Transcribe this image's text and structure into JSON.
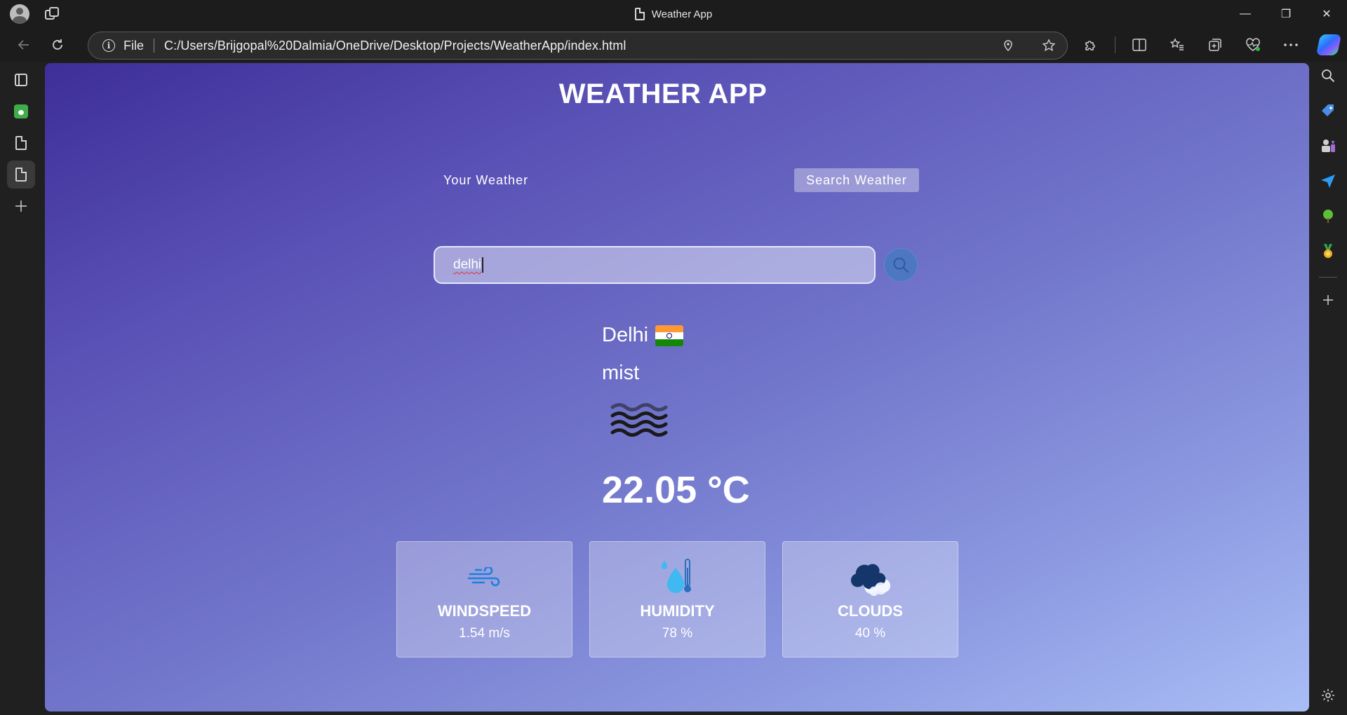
{
  "window": {
    "title": "Weather App",
    "controls": {
      "minimize": "—",
      "restore": "❐",
      "close": "✕"
    }
  },
  "address_bar": {
    "scheme_label": "File",
    "url": "C:/Users/Brijgopal%20Dalmia/OneDrive/Desktop/Projects/WeatherApp/index.html"
  },
  "app": {
    "title": "WEATHER APP",
    "tabs": [
      {
        "label": "Your Weather",
        "active": false
      },
      {
        "label": "Search Weather",
        "active": true
      }
    ],
    "search": {
      "value": "delhi"
    },
    "result": {
      "city": "Delhi",
      "country_flag": "india-flag-icon",
      "description": "mist",
      "weather_icon": "mist-icon",
      "temperature": "22.05 °C"
    },
    "stats": [
      {
        "label": "WINDSPEED",
        "value": "1.54 m/s",
        "icon": "wind-icon"
      },
      {
        "label": "HUMIDITY",
        "value": "78 %",
        "icon": "humidity-icon"
      },
      {
        "label": "CLOUDS",
        "value": "40 %",
        "icon": "cloud-icon"
      }
    ]
  },
  "colors": {
    "page_gradient_start": "#3e2e98",
    "page_gradient_end": "#a9bdf6",
    "search_button": "#4e77c2",
    "browser_chrome": "#1c1c1c"
  }
}
